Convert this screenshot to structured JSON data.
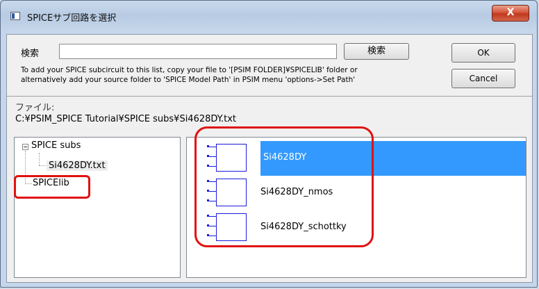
{
  "window": {
    "title": "SPICEサブ回路を選択",
    "close_symbol": "X"
  },
  "search": {
    "label": "検索",
    "value": "",
    "button_label": "検索"
  },
  "buttons": {
    "ok": "OK",
    "cancel": "Cancel"
  },
  "help": {
    "line1": "To add your SPICE subcircuit to this list, copy your file to '[PSIM FOLDER]¥SPICELIB' folder or",
    "line2": "alternatively add your source folder to 'SPICE Model Path' in PSIM menu 'options->Set Path'"
  },
  "file": {
    "label": "ファイル:",
    "path": "C:¥PSIM_SPICE Tutorial¥SPICE subs¥Si4628DY.txt"
  },
  "tree": {
    "root": "SPICE subs",
    "child": "Si4628DY.txt",
    "second_root": "SPICElib"
  },
  "subcircuits": [
    {
      "label": "Si4628DY",
      "selected": true
    },
    {
      "label": "Si4628DY_nmos",
      "selected": false
    },
    {
      "label": "Si4628DY_schottky",
      "selected": false
    }
  ],
  "colors": {
    "selection": "#3399ff",
    "highlight_annotation": "#e01010",
    "symbol": "#1a1adb"
  }
}
